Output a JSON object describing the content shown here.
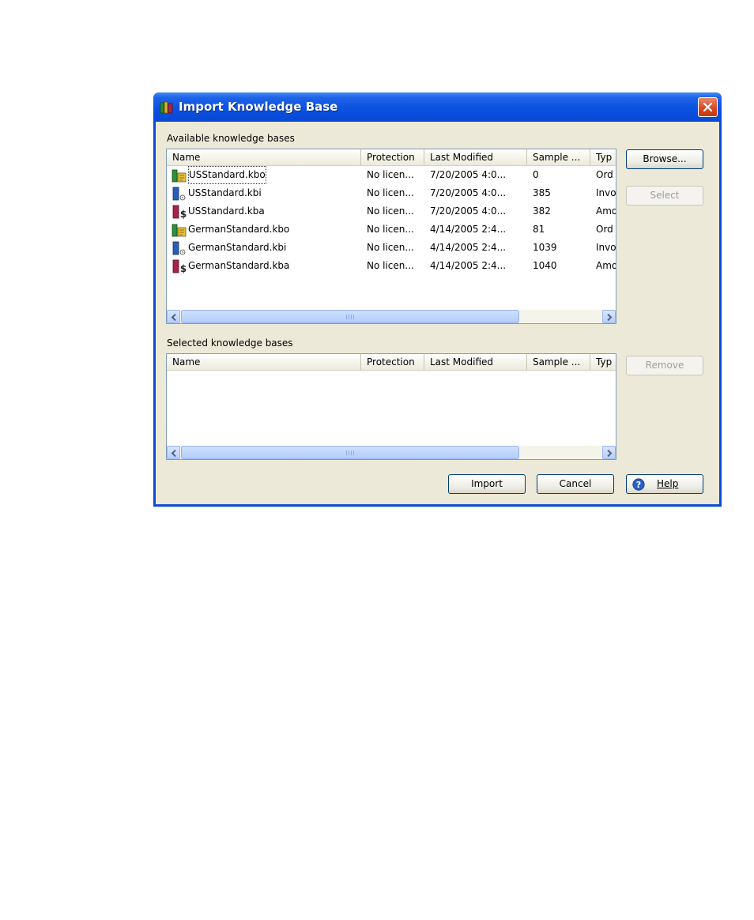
{
  "window": {
    "title": "Import Knowledge Base"
  },
  "available": {
    "label": "Available knowledge bases",
    "columns": [
      "Name",
      "Protection",
      "Last Modified",
      "Sample ...",
      "Typ"
    ],
    "rows": [
      {
        "icon": "order-book-icon",
        "name": "USStandard.kbo",
        "protection": "No licen...",
        "modified": "7/20/2005 4:0...",
        "sample": "0",
        "type": "Ord"
      },
      {
        "icon": "invoice-book-icon",
        "name": "USStandard.kbi",
        "protection": "No licen...",
        "modified": "7/20/2005 4:0...",
        "sample": "385",
        "type": "Invo"
      },
      {
        "icon": "amount-book-icon",
        "name": "USStandard.kba",
        "protection": "No licen...",
        "modified": "7/20/2005 4:0...",
        "sample": "382",
        "type": "Amo"
      },
      {
        "icon": "order-book-icon",
        "name": "GermanStandard.kbo",
        "protection": "No licen...",
        "modified": "4/14/2005 2:4...",
        "sample": "81",
        "type": "Ord"
      },
      {
        "icon": "invoice-book-icon",
        "name": "GermanStandard.kbi",
        "protection": "No licen...",
        "modified": "4/14/2005 2:4...",
        "sample": "1039",
        "type": "Invo"
      },
      {
        "icon": "amount-book-icon",
        "name": "GermanStandard.kba",
        "protection": "No licen...",
        "modified": "4/14/2005 2:4...",
        "sample": "1040",
        "type": "Amo"
      }
    ]
  },
  "selected": {
    "label": "Selected knowledge bases",
    "columns": [
      "Name",
      "Protection",
      "Last Modified",
      "Sample ...",
      "Typ"
    ]
  },
  "buttons": {
    "browse": "Browse...",
    "select": "Select",
    "remove": "Remove",
    "import": "Import",
    "cancel": "Cancel",
    "help": "Help"
  },
  "colors": {
    "titlebar": "#0b52e0",
    "dialog_bg": "#ece9d8",
    "close": "#d3461f"
  }
}
